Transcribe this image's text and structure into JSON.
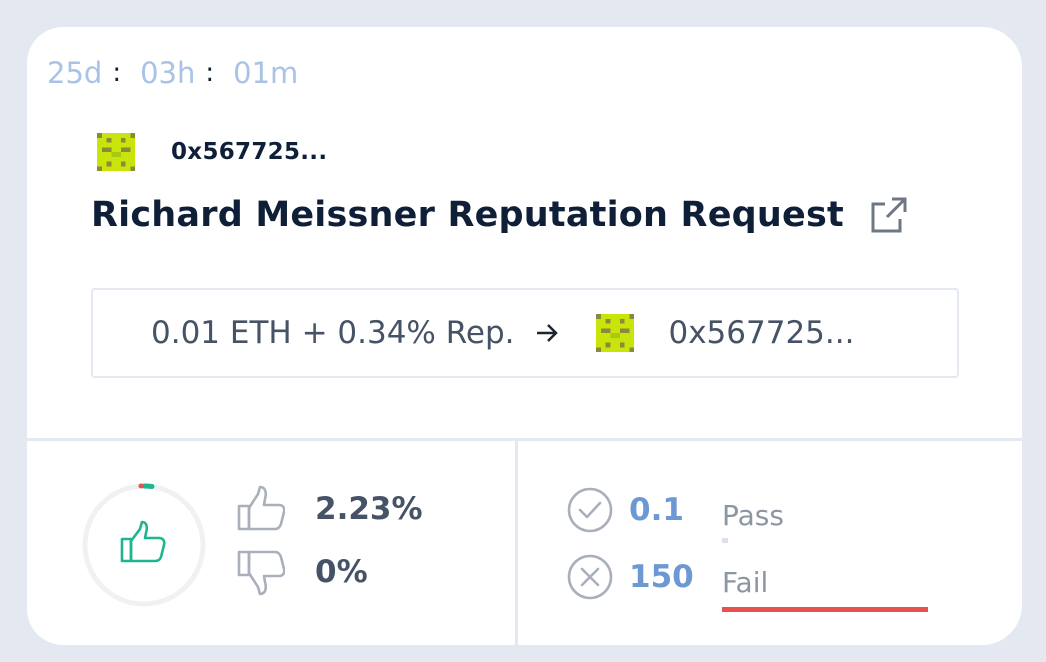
{
  "countdown": {
    "days": "25d",
    "hours": "03h",
    "minutes": "01m",
    "separator": ":"
  },
  "creator": {
    "address": "0x567725...",
    "avatar_icon": "pixel-identicon"
  },
  "title": "Richard Meissner Reputation Request",
  "title_link_icon": "external-link-icon",
  "payout": {
    "amount": "0.01 ETH + 0.34% Rep.",
    "arrow_icon": "arrow-right-icon",
    "recipient_address": "0x567725..."
  },
  "votes": {
    "up_percent": "2.23%",
    "down_percent": "0%",
    "up_icon": "thumbs-up-icon",
    "down_icon": "thumbs-down-icon",
    "ring_icon": "thumbs-up-icon",
    "support_fraction": 0.0223
  },
  "stakes": {
    "pass_value": "0.1",
    "pass_label": "Pass",
    "fail_value": "150",
    "fail_label": "Fail",
    "pass_fraction": 0.0007,
    "fail_fraction": 1.0
  },
  "colors": {
    "page_background": "#e3e8f1",
    "navy_text": "#0f1f38",
    "countdown_blue": "#a8c3e6",
    "stake_blue": "#6c98d4",
    "vote_green": "#1fb590",
    "vote_red": "#e9514f",
    "fail_bar_red": "#e9514f",
    "identicon_lime": "#c9e40b",
    "identicon_olive": "#8a8a3a"
  }
}
